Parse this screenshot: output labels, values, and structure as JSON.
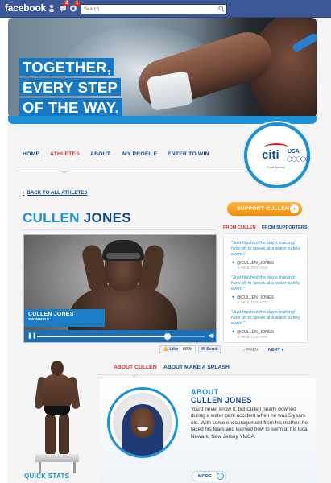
{
  "facebook": {
    "logo": "facebook",
    "search_placeholder": "Search",
    "badges": [
      "2",
      "1"
    ]
  },
  "hero": {
    "tagline": [
      "TOGETHER,",
      "EVERY STEP",
      "OF THE WAY."
    ]
  },
  "nav": {
    "items": [
      {
        "label": "HOME"
      },
      {
        "label": "ATHLETES",
        "active": true
      },
      {
        "label": "ABOUT"
      },
      {
        "label": "MY PROFILE"
      },
      {
        "label": "ENTER TO WIN"
      }
    ]
  },
  "sponsor": {
    "brand": "citi",
    "team": "USA",
    "rings": "◯◯◯◯◯",
    "tagline": "Proud Sponsor"
  },
  "back_link": "BACK TO ALL ATHLETES",
  "athlete": {
    "first": "CULLEN",
    "last": "JONES"
  },
  "support_button": "SUPPORT CULLEN",
  "video": {
    "name": "CULLEN JONES",
    "sport": "SWIMMING",
    "progress": 0.78
  },
  "social": {
    "like": "Like",
    "count": "689k",
    "send": "Send"
  },
  "feed": {
    "tab_from_athlete": "FROM CULLEN",
    "tab_from_supporters": "FROM SUPPORTERS",
    "tweets": [
      {
        "text": "\"Just finished the day's training! Now off to speak at a water safety event.\"",
        "handle": "@CULLEN_JONES",
        "time": "5 MINUTES AGO"
      },
      {
        "text": "\"Just finished the day's training! Now off to speak at a water safety event.\"",
        "handle": "@CULLEN_JONES",
        "time": "5 MINUTES AGO"
      },
      {
        "text": "\"Just finished the day's training! Now off to speak at a water safety event.\"",
        "handle": "@CULLEN_JONES",
        "time": "5 MINUTES AGO"
      }
    ],
    "prev": "PREV",
    "next": "NEXT"
  },
  "bottom_tabs": {
    "about": "ABOUT CULLEN",
    "make_splash": "ABOUT MAKE A SPLASH"
  },
  "quick_stats": "QUICK STATS",
  "about": {
    "heading": "ABOUT",
    "name": "CULLEN JONES",
    "text": "You'd never know it, but Cullen nearly downed during a water park accident when he was 5 years old. With some encouragement from his mother, he faced his fears and learned how to swim at his local Newark, New Jersey YMCA.",
    "more": "MORE"
  },
  "colors": {
    "fb_blue": "#3b5998",
    "citi_blue": "#104b8c",
    "light_blue": "#1b92d6",
    "red": "#d0312d",
    "orange": "#f28a00"
  }
}
